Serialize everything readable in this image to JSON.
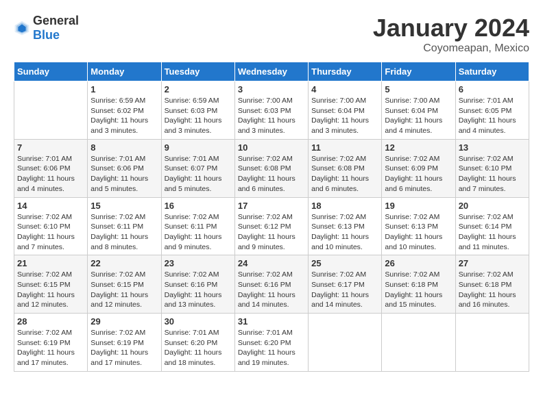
{
  "header": {
    "logo_general": "General",
    "logo_blue": "Blue",
    "month_title": "January 2024",
    "location": "Coyomeapan, Mexico"
  },
  "weekdays": [
    "Sunday",
    "Monday",
    "Tuesday",
    "Wednesday",
    "Thursday",
    "Friday",
    "Saturday"
  ],
  "weeks": [
    [
      {
        "day": "",
        "sunrise": "",
        "sunset": "",
        "daylight": ""
      },
      {
        "day": "1",
        "sunrise": "Sunrise: 6:59 AM",
        "sunset": "Sunset: 6:02 PM",
        "daylight": "Daylight: 11 hours and 3 minutes."
      },
      {
        "day": "2",
        "sunrise": "Sunrise: 6:59 AM",
        "sunset": "Sunset: 6:03 PM",
        "daylight": "Daylight: 11 hours and 3 minutes."
      },
      {
        "day": "3",
        "sunrise": "Sunrise: 7:00 AM",
        "sunset": "Sunset: 6:03 PM",
        "daylight": "Daylight: 11 hours and 3 minutes."
      },
      {
        "day": "4",
        "sunrise": "Sunrise: 7:00 AM",
        "sunset": "Sunset: 6:04 PM",
        "daylight": "Daylight: 11 hours and 3 minutes."
      },
      {
        "day": "5",
        "sunrise": "Sunrise: 7:00 AM",
        "sunset": "Sunset: 6:04 PM",
        "daylight": "Daylight: 11 hours and 4 minutes."
      },
      {
        "day": "6",
        "sunrise": "Sunrise: 7:01 AM",
        "sunset": "Sunset: 6:05 PM",
        "daylight": "Daylight: 11 hours and 4 minutes."
      }
    ],
    [
      {
        "day": "7",
        "sunrise": "Sunrise: 7:01 AM",
        "sunset": "Sunset: 6:06 PM",
        "daylight": "Daylight: 11 hours and 4 minutes."
      },
      {
        "day": "8",
        "sunrise": "Sunrise: 7:01 AM",
        "sunset": "Sunset: 6:06 PM",
        "daylight": "Daylight: 11 hours and 5 minutes."
      },
      {
        "day": "9",
        "sunrise": "Sunrise: 7:01 AM",
        "sunset": "Sunset: 6:07 PM",
        "daylight": "Daylight: 11 hours and 5 minutes."
      },
      {
        "day": "10",
        "sunrise": "Sunrise: 7:02 AM",
        "sunset": "Sunset: 6:08 PM",
        "daylight": "Daylight: 11 hours and 6 minutes."
      },
      {
        "day": "11",
        "sunrise": "Sunrise: 7:02 AM",
        "sunset": "Sunset: 6:08 PM",
        "daylight": "Daylight: 11 hours and 6 minutes."
      },
      {
        "day": "12",
        "sunrise": "Sunrise: 7:02 AM",
        "sunset": "Sunset: 6:09 PM",
        "daylight": "Daylight: 11 hours and 6 minutes."
      },
      {
        "day": "13",
        "sunrise": "Sunrise: 7:02 AM",
        "sunset": "Sunset: 6:10 PM",
        "daylight": "Daylight: 11 hours and 7 minutes."
      }
    ],
    [
      {
        "day": "14",
        "sunrise": "Sunrise: 7:02 AM",
        "sunset": "Sunset: 6:10 PM",
        "daylight": "Daylight: 11 hours and 7 minutes."
      },
      {
        "day": "15",
        "sunrise": "Sunrise: 7:02 AM",
        "sunset": "Sunset: 6:11 PM",
        "daylight": "Daylight: 11 hours and 8 minutes."
      },
      {
        "day": "16",
        "sunrise": "Sunrise: 7:02 AM",
        "sunset": "Sunset: 6:11 PM",
        "daylight": "Daylight: 11 hours and 9 minutes."
      },
      {
        "day": "17",
        "sunrise": "Sunrise: 7:02 AM",
        "sunset": "Sunset: 6:12 PM",
        "daylight": "Daylight: 11 hours and 9 minutes."
      },
      {
        "day": "18",
        "sunrise": "Sunrise: 7:02 AM",
        "sunset": "Sunset: 6:13 PM",
        "daylight": "Daylight: 11 hours and 10 minutes."
      },
      {
        "day": "19",
        "sunrise": "Sunrise: 7:02 AM",
        "sunset": "Sunset: 6:13 PM",
        "daylight": "Daylight: 11 hours and 10 minutes."
      },
      {
        "day": "20",
        "sunrise": "Sunrise: 7:02 AM",
        "sunset": "Sunset: 6:14 PM",
        "daylight": "Daylight: 11 hours and 11 minutes."
      }
    ],
    [
      {
        "day": "21",
        "sunrise": "Sunrise: 7:02 AM",
        "sunset": "Sunset: 6:15 PM",
        "daylight": "Daylight: 11 hours and 12 minutes."
      },
      {
        "day": "22",
        "sunrise": "Sunrise: 7:02 AM",
        "sunset": "Sunset: 6:15 PM",
        "daylight": "Daylight: 11 hours and 12 minutes."
      },
      {
        "day": "23",
        "sunrise": "Sunrise: 7:02 AM",
        "sunset": "Sunset: 6:16 PM",
        "daylight": "Daylight: 11 hours and 13 minutes."
      },
      {
        "day": "24",
        "sunrise": "Sunrise: 7:02 AM",
        "sunset": "Sunset: 6:16 PM",
        "daylight": "Daylight: 11 hours and 14 minutes."
      },
      {
        "day": "25",
        "sunrise": "Sunrise: 7:02 AM",
        "sunset": "Sunset: 6:17 PM",
        "daylight": "Daylight: 11 hours and 14 minutes."
      },
      {
        "day": "26",
        "sunrise": "Sunrise: 7:02 AM",
        "sunset": "Sunset: 6:18 PM",
        "daylight": "Daylight: 11 hours and 15 minutes."
      },
      {
        "day": "27",
        "sunrise": "Sunrise: 7:02 AM",
        "sunset": "Sunset: 6:18 PM",
        "daylight": "Daylight: 11 hours and 16 minutes."
      }
    ],
    [
      {
        "day": "28",
        "sunrise": "Sunrise: 7:02 AM",
        "sunset": "Sunset: 6:19 PM",
        "daylight": "Daylight: 11 hours and 17 minutes."
      },
      {
        "day": "29",
        "sunrise": "Sunrise: 7:02 AM",
        "sunset": "Sunset: 6:19 PM",
        "daylight": "Daylight: 11 hours and 17 minutes."
      },
      {
        "day": "30",
        "sunrise": "Sunrise: 7:01 AM",
        "sunset": "Sunset: 6:20 PM",
        "daylight": "Daylight: 11 hours and 18 minutes."
      },
      {
        "day": "31",
        "sunrise": "Sunrise: 7:01 AM",
        "sunset": "Sunset: 6:20 PM",
        "daylight": "Daylight: 11 hours and 19 minutes."
      },
      {
        "day": "",
        "sunrise": "",
        "sunset": "",
        "daylight": ""
      },
      {
        "day": "",
        "sunrise": "",
        "sunset": "",
        "daylight": ""
      },
      {
        "day": "",
        "sunrise": "",
        "sunset": "",
        "daylight": ""
      }
    ]
  ]
}
